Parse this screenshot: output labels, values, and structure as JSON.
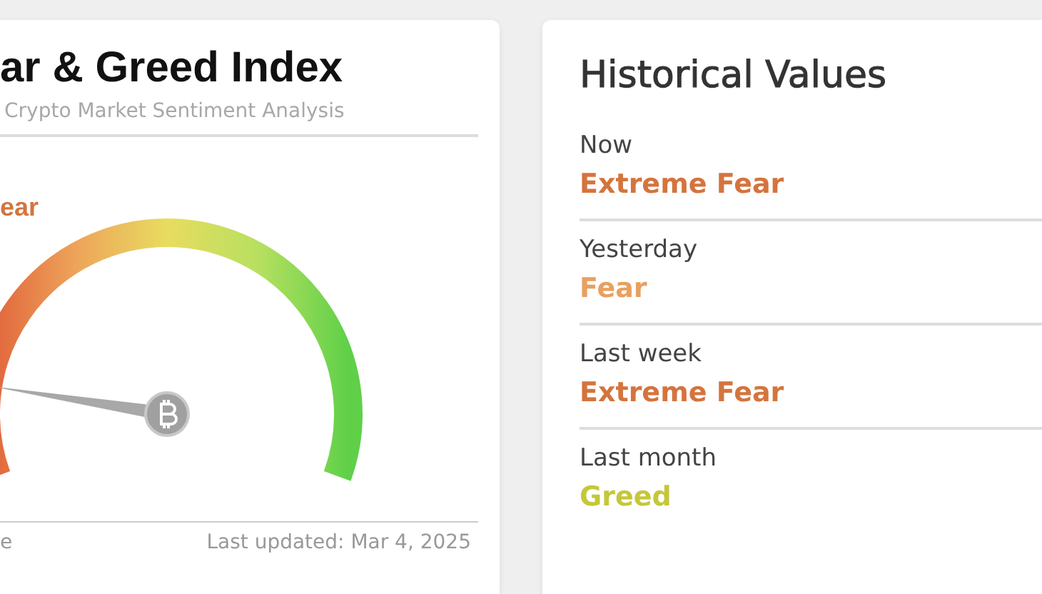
{
  "index_card": {
    "title": "ar & Greed Index",
    "subtitle": "Crypto Market Sentiment Analysis",
    "sentiment": "ear",
    "footer_left": "e",
    "last_updated": "Last updated: Mar 4, 2025"
  },
  "historical": {
    "title": "Historical Values",
    "rows": [
      {
        "label": "Now",
        "value": "Extreme Fear",
        "color": "#d4743e"
      },
      {
        "label": "Yesterday",
        "value": "Fear",
        "color": "#e8a060"
      },
      {
        "label": "Last week",
        "value": "Extreme Fear",
        "color": "#d4743e"
      },
      {
        "label": "Last month",
        "value": "Greed",
        "color": "#c5c73a"
      }
    ]
  }
}
